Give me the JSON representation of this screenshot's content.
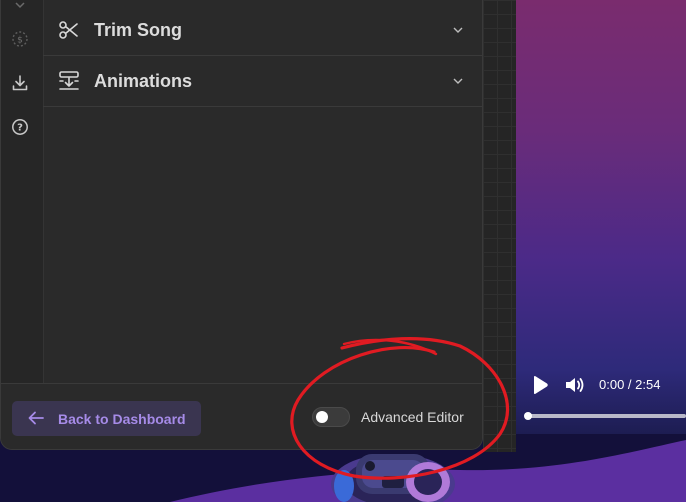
{
  "sidebar": {
    "icons": [
      "chevron-icon",
      "coin-icon",
      "download-icon",
      "help-icon"
    ]
  },
  "sections": [
    {
      "title": "Trim Song",
      "icon": "scissors-icon"
    },
    {
      "title": "Animations",
      "icon": "animation-icon"
    }
  ],
  "footer": {
    "back_label": "Back to Dashboard",
    "advanced_editor_label": "Advanced Editor",
    "advanced_editor_on": false
  },
  "player": {
    "time": "0:00 / 2:54",
    "progress_fraction": 0.0
  },
  "colors": {
    "accent": "#a68be8",
    "annotation": "#e01b22"
  }
}
